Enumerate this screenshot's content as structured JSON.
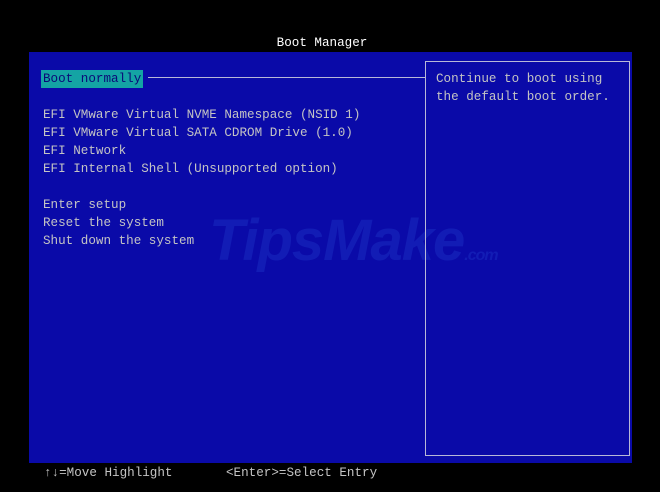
{
  "title": "Boot Manager",
  "menu": {
    "selected": "Boot normally",
    "boot_options": [
      "EFI VMware Virtual NVME Namespace (NSID 1)",
      "EFI VMware Virtual SATA CDROM Drive (1.0)",
      "EFI Network",
      "EFI Internal Shell (Unsupported option)"
    ],
    "actions": [
      "Enter setup",
      "Reset the system",
      "Shut down the system"
    ]
  },
  "help": {
    "text": "Continue to boot using the default boot order."
  },
  "watermark": "TipsMake.com",
  "footer": {
    "move": "↑↓=Move Highlight",
    "select": "<Enter>=Select Entry"
  },
  "colors": {
    "background": "#0a0aa8",
    "highlight": "#14a4a4",
    "text": "#c4c4c4"
  }
}
